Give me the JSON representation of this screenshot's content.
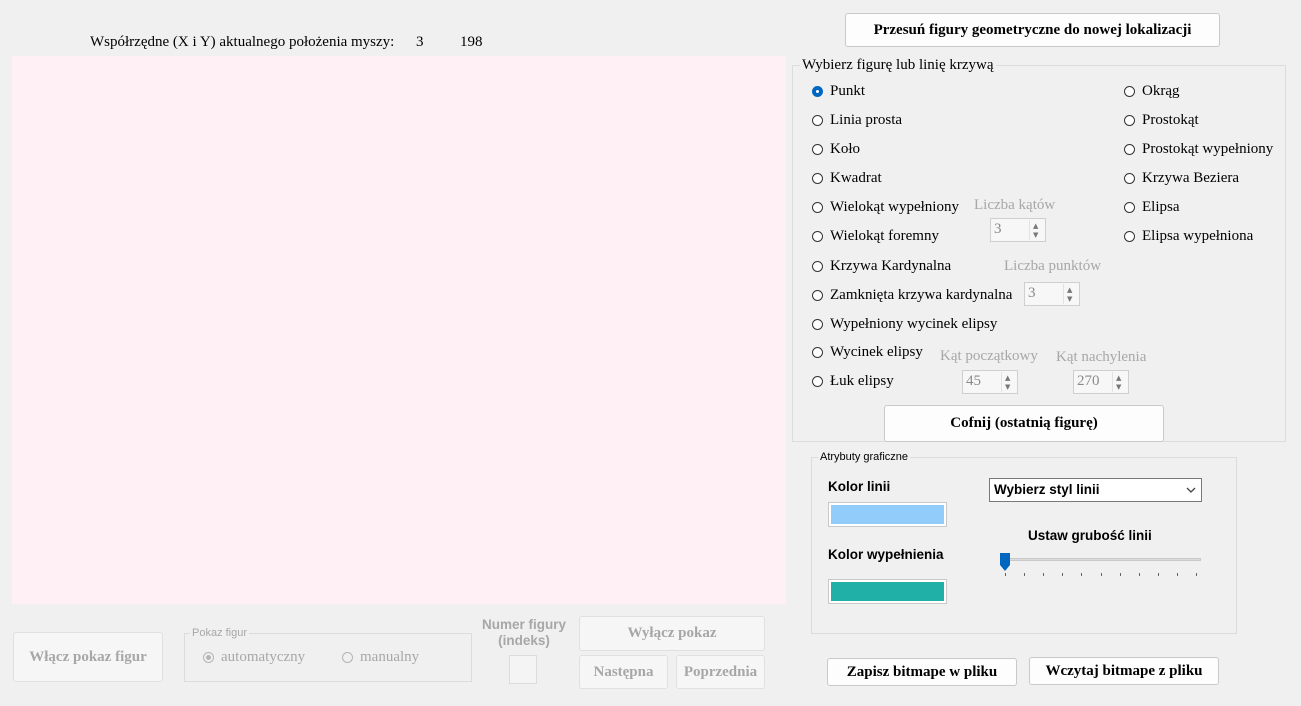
{
  "coords": {
    "label": "Współrzędne (X i Y) aktualnego położenia myszy:",
    "x": "3",
    "y": "198"
  },
  "colors": {
    "canvas": "#fff0f5",
    "line_color": "#91ccfb",
    "fill_color": "#21b0a8",
    "accent": "#0067c0"
  },
  "move_button": "Przesuń figury geometryczne do nowej lokalizacji",
  "figure_group": {
    "title": "Wybierz figurę lub linię krzywą",
    "left_options": [
      "Punkt",
      "Linia prosta",
      "Koło",
      "Kwadrat",
      "Wielokąt wypełniony",
      "Wielokąt foremny",
      "Krzywa Kardynalna",
      "Zamknięta krzywa kardynalna",
      "Wypełniony wycinek elipsy",
      "Wycinek elipsy",
      "Łuk elipsy"
    ],
    "right_options": [
      "Okrąg",
      "Prostokąt",
      "Prostokąt wypełniony",
      "Krzywa Beziera",
      "Elipsa",
      "Elipsa wypełniona"
    ],
    "selected": "Punkt",
    "angles_label": "Liczba kątów",
    "angles_value": "3",
    "points_label": "Liczba punktów",
    "points_value": "3",
    "start_angle_label": "Kąt początkowy",
    "start_angle_value": "45",
    "sweep_angle_label": "Kąt nachylenia",
    "sweep_angle_value": "270",
    "undo_button": "Cofnij (ostatnią figurę)"
  },
  "attributes": {
    "title": "Atrybuty graficzne",
    "line_color_label": "Kolor linii",
    "fill_color_label": "Kolor wypełnienia",
    "line_style_select": "Wybierz styl linii",
    "line_width_label": "Ustaw grubość linii",
    "line_width_value": 0
  },
  "slideshow": {
    "start_button": "Włącz pokaz figur",
    "mode_title": "Pokaz figur",
    "mode_auto": "automatyczny",
    "mode_manual": "manualny",
    "index_label_1": "Numer figury",
    "index_label_2": "(indeks)",
    "stop_button": "Wyłącz pokaz",
    "next_button": "Następna",
    "prev_button": "Poprzednia"
  },
  "bitmap": {
    "save_button": "Zapisz bitmape w pliku",
    "load_button": "Wczytaj bitmape z pliku"
  }
}
